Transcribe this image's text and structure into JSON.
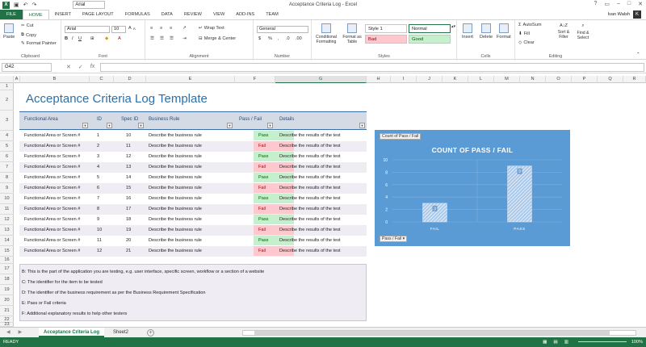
{
  "window": {
    "title": "Acceptance Criteria Log - Excel",
    "font_name": "Arial",
    "user": "Ivan Walsh",
    "user_initial": "K"
  },
  "tabs": [
    "FILE",
    "HOME",
    "INSERT",
    "PAGE LAYOUT",
    "FORMULAS",
    "DATA",
    "REVIEW",
    "VIEW",
    "ADD-INS",
    "TEAM"
  ],
  "ribbon": {
    "clipboard": {
      "paste": "Paste",
      "cut": "Cut",
      "copy": "Copy",
      "format_painter": "Format Painter",
      "label": "Clipboard"
    },
    "font": {
      "name": "Arial",
      "size": "10",
      "label": "Font"
    },
    "alignment": {
      "wrap": "Wrap Text",
      "merge": "Merge & Center",
      "label": "Alignment"
    },
    "number": {
      "format": "General",
      "label": "Number"
    },
    "styles": {
      "conditional": "Conditional Formatting",
      "format_table": "Format as Table",
      "style1": "Style 1",
      "normal": "Normal",
      "bad": "Bad",
      "good": "Good",
      "label": "Styles"
    },
    "cells": {
      "insert": "Insert",
      "delete": "Delete",
      "format": "Format",
      "label": "Cells"
    },
    "editing": {
      "autosum": "AutoSum",
      "fill": "Fill",
      "clear": "Clear",
      "sort": "Sort & Filter",
      "find": "Find & Select",
      "label": "Editing"
    }
  },
  "formula_bar": {
    "name_box": "G42",
    "content": ""
  },
  "columns": [
    "A",
    "B",
    "C",
    "D",
    "E",
    "F",
    "G",
    "H",
    "I",
    "J",
    "K",
    "L",
    "M",
    "N",
    "O",
    "P",
    "Q",
    "R"
  ],
  "rows": [
    "1",
    "2",
    "3",
    "4",
    "5",
    "6",
    "7",
    "8",
    "9",
    "10",
    "11",
    "12",
    "13",
    "14",
    "15",
    "16",
    "17",
    "18",
    "19",
    "20",
    "21",
    "22",
    "23",
    "24"
  ],
  "sheet": {
    "title": "Acceptance Criteria Log Template",
    "headers": {
      "area": "Functional Area",
      "id": "ID",
      "spec": "Spec ID",
      "rule": "Business Rule",
      "pf": "Pass / Fail",
      "details": "Details"
    },
    "rows": [
      {
        "area": "Functional Area or Screen #",
        "id": "1",
        "spec": "10",
        "rule": "Describe the business rule",
        "pf": "Pass",
        "details": "Describe the results of the test"
      },
      {
        "area": "Functional Area or Screen #",
        "id": "2",
        "spec": "11",
        "rule": "Describe the business rule",
        "pf": "Fail",
        "details": "Describe the results of the test"
      },
      {
        "area": "Functional Area or Screen #",
        "id": "3",
        "spec": "12",
        "rule": "Describe the business rule",
        "pf": "Pass",
        "details": "Describe the results of the test"
      },
      {
        "area": "Functional Area or Screen #",
        "id": "4",
        "spec": "13",
        "rule": "Describe the business rule",
        "pf": "Fail",
        "details": "Describe the results of the test"
      },
      {
        "area": "Functional Area or Screen #",
        "id": "5",
        "spec": "14",
        "rule": "Describe the business rule",
        "pf": "Pass",
        "details": "Describe the results of the test"
      },
      {
        "area": "Functional Area or Screen #",
        "id": "6",
        "spec": "15",
        "rule": "Describe the business rule",
        "pf": "Fail",
        "details": "Describe the results of the test"
      },
      {
        "area": "Functional Area or Screen #",
        "id": "7",
        "spec": "16",
        "rule": "Describe the business rule",
        "pf": "Pass",
        "details": "Describe the results of the test"
      },
      {
        "area": "Functional Area or Screen #",
        "id": "8",
        "spec": "17",
        "rule": "Describe the business rule",
        "pf": "Fail",
        "details": "Describe the results of the test"
      },
      {
        "area": "Functional Area or Screen #",
        "id": "9",
        "spec": "18",
        "rule": "Describe the business rule",
        "pf": "Pass",
        "details": "Describe the results of the test"
      },
      {
        "area": "Functional Area or Screen #",
        "id": "10",
        "spec": "19",
        "rule": "Describe the business rule",
        "pf": "Fail",
        "details": "Describe the results of the test"
      },
      {
        "area": "Functional Area or Screen #",
        "id": "11",
        "spec": "20",
        "rule": "Describe the business rule",
        "pf": "Pass",
        "details": "Describe the results of the test"
      },
      {
        "area": "Functional Area or Screen #",
        "id": "12",
        "spec": "21",
        "rule": "Describe the business rule",
        "pf": "Fail",
        "details": "Describe the results of the test"
      }
    ],
    "notes": [
      "B: This is the part of the application you are testing, e.g. user interface, specific screen, workflow or a section of a website",
      "C: The identifier for the item to be tested",
      "D: The identifier of the business requirement as per the Business Requirement Specification",
      "E: Pass or Fail criteria",
      "F: Additional explanatory results to help other testers"
    ]
  },
  "chart_data": {
    "type": "bar",
    "title": "COUNT OF PASS / FAIL",
    "field_button": "Count of Pass / Fail",
    "axis_button": "Pass / Fail ▾",
    "categories": [
      "FAIL",
      "PASS"
    ],
    "values": [
      3,
      9
    ],
    "ylim": [
      0,
      10
    ],
    "yticks": [
      0,
      2,
      4,
      6,
      8,
      10
    ],
    "grid": true,
    "colors": {
      "background": "#5b9bd5",
      "bar": "#ffffff"
    }
  },
  "sheet_tabs": [
    "Acceptance Criteria Log",
    "Sheet2"
  ],
  "status": {
    "ready": "READY",
    "zoom": "100%"
  }
}
